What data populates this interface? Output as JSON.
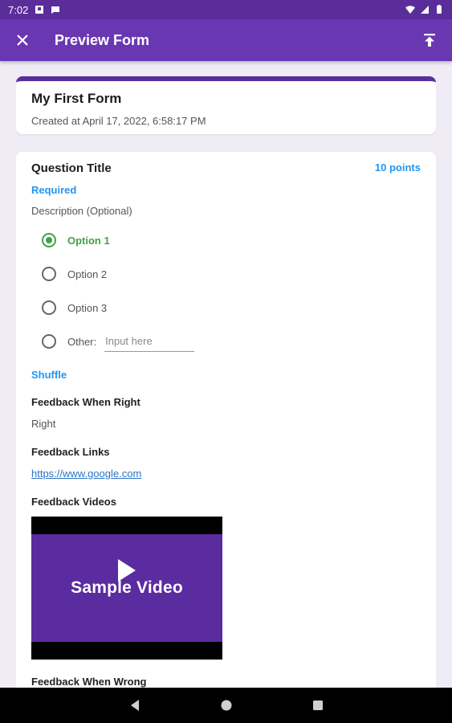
{
  "status_bar": {
    "time": "7:02"
  },
  "app_bar": {
    "title": "Preview Form"
  },
  "form": {
    "title": "My First Form",
    "created": "Created at April 17, 2022, 6:58:17 PM"
  },
  "question": {
    "title": "Question Title",
    "points": "10 points",
    "required": "Required",
    "description": "Description (Optional)",
    "options": [
      {
        "label": "Option 1",
        "selected": true
      },
      {
        "label": "Option 2",
        "selected": false
      },
      {
        "label": "Option 3",
        "selected": false
      }
    ],
    "other_label": "Other:",
    "other_placeholder": "Input here",
    "shuffle": "Shuffle"
  },
  "feedback": {
    "right_label": "Feedback When Right",
    "right_value": "Right",
    "links_label": "Feedback Links",
    "link": "https://www.google.com",
    "videos_label": "Feedback Videos",
    "video_text": "Sample Video",
    "wrong_label": "Feedback When Wrong"
  },
  "colors": {
    "accent": "#6a37b2",
    "link_blue": "#2196f3",
    "selected_green": "#43a047"
  },
  "icons": [
    "close-icon",
    "publish-icon",
    "back-icon",
    "home-icon",
    "recents-icon",
    "wifi-icon",
    "battery-icon"
  ]
}
